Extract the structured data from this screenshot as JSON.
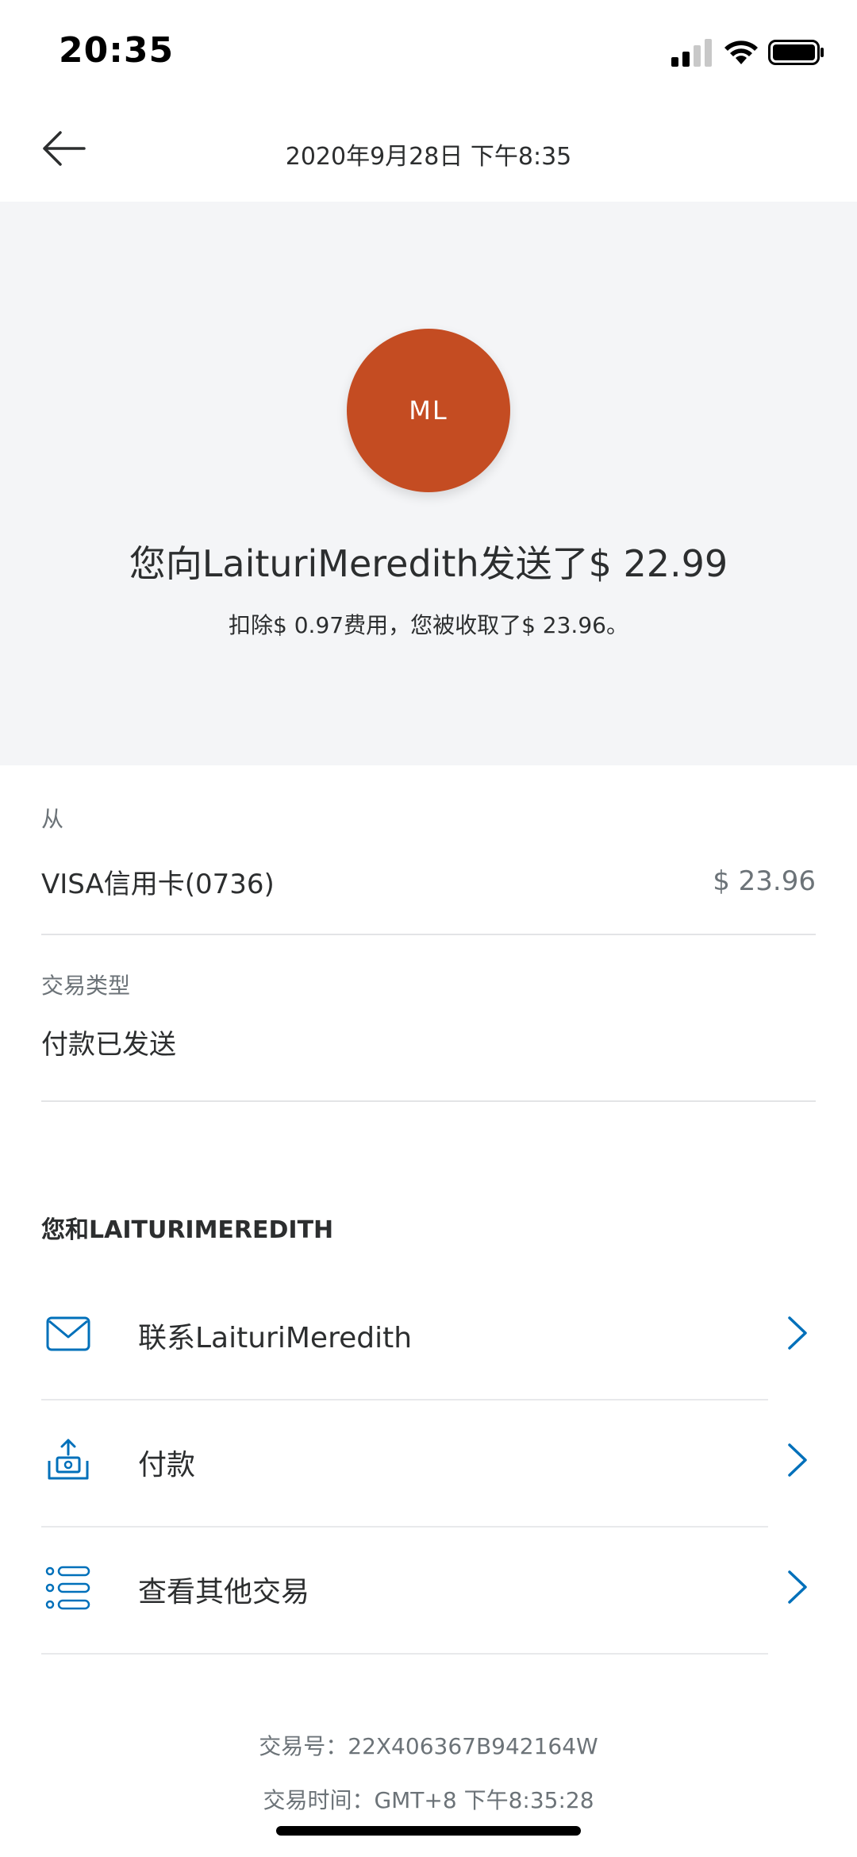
{
  "status_bar": {
    "time": "20:35"
  },
  "header": {
    "title": "2020年9月28日  下午8:35"
  },
  "hero": {
    "avatar_initials": "ML",
    "avatar_color": "#c44c22",
    "title": "您向LaituriMeredith发送了$ 22.99",
    "subtitle": "扣除$ 0.97费用，您被收取了$ 23.96。"
  },
  "details": {
    "from_label": "从",
    "from_value": "VISA信用卡(0736)",
    "from_amount": "$ 23.96",
    "type_label": "交易类型",
    "type_value": "付款已发送"
  },
  "section_heading": "您和LAITURIMEREDITH",
  "actions": [
    {
      "label": "联系LaituriMeredith",
      "icon": "mail-icon"
    },
    {
      "label": "付款",
      "icon": "send-money-icon"
    },
    {
      "label": "查看其他交易",
      "icon": "list-icon"
    }
  ],
  "footer": {
    "transaction_id": "交易号：22X406367B942164W",
    "transaction_time": "交易时间：GMT+8 下午8:35:28"
  },
  "colors": {
    "accent": "#0070ba",
    "hero_bg": "#f4f5f7"
  }
}
